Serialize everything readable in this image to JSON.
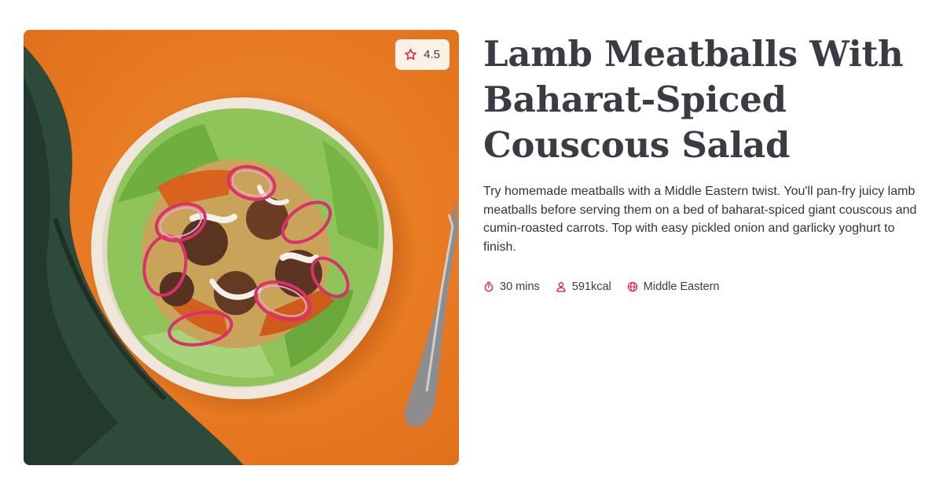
{
  "recipe": {
    "title": "Lamb Meatballs With Baharat-Spiced Couscous Salad",
    "description": "Try homemade meatballs with a Middle Eastern twist. You'll pan-fry juicy lamb meatballs before serving them on a bed of baharat-spiced giant couscous and cumin-roasted carrots. Top with easy pickled onion and garlicky yoghurt to finish.",
    "rating": "4.5",
    "cook_time": "30 mins",
    "calories": "591kcal",
    "cuisine": "Middle Eastern"
  },
  "icons": {
    "rating": "star-icon",
    "time": "stopwatch-icon",
    "calories": "person-icon",
    "cuisine": "globe-icon"
  },
  "colors": {
    "accent": "#e5243f",
    "title": "#3b3b43",
    "body_text": "#33333b",
    "badge_bg": "#fbf1e7",
    "image_background": "#ea7a22"
  }
}
